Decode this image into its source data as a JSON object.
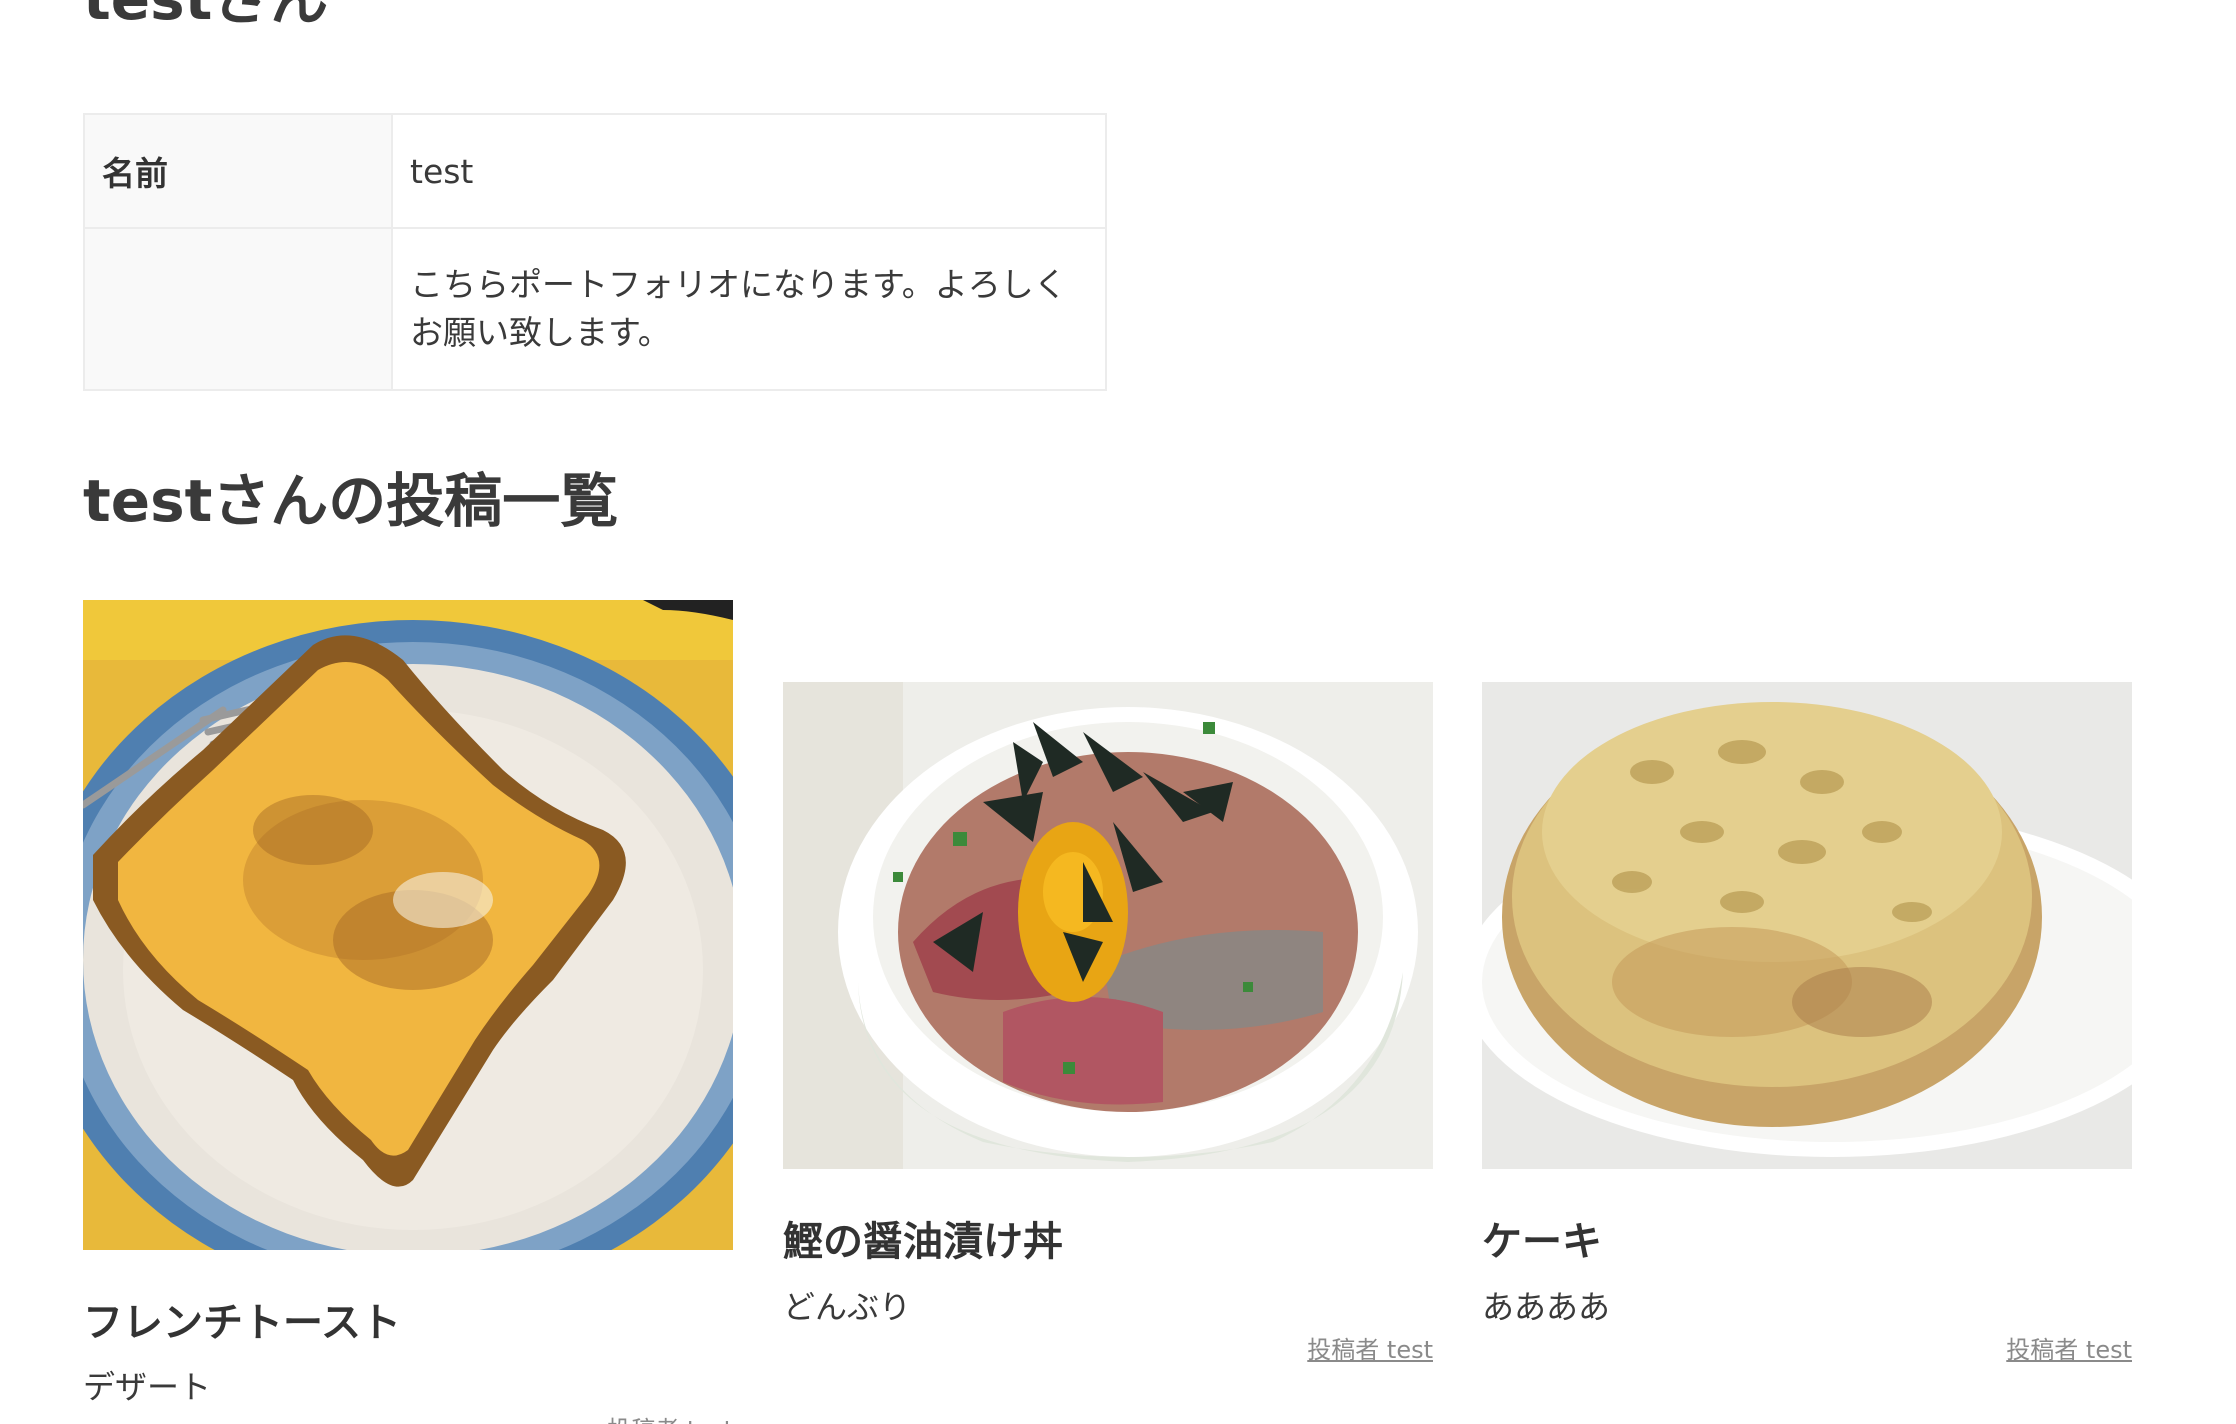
{
  "profile": {
    "title": "testさん",
    "table": {
      "name_label": "名前",
      "name_value": "test",
      "intro_label": "",
      "intro_value": "こちらポートフォリオになります。よろしくお願い致します。"
    }
  },
  "posts": {
    "heading": "testさんの投稿一覧",
    "items": [
      {
        "title": "フレンチトースト",
        "category": "デザート",
        "author": "投稿者 test",
        "image": "french-toast-photo"
      },
      {
        "title": "鰹の醤油漬け丼",
        "category": "どんぶり",
        "author": "投稿者 test",
        "image": "bonito-rice-bowl-photo"
      },
      {
        "title": "ケーキ",
        "category": "ああああ",
        "author": "投稿者 test",
        "image": "banana-cake-photo"
      }
    ]
  }
}
